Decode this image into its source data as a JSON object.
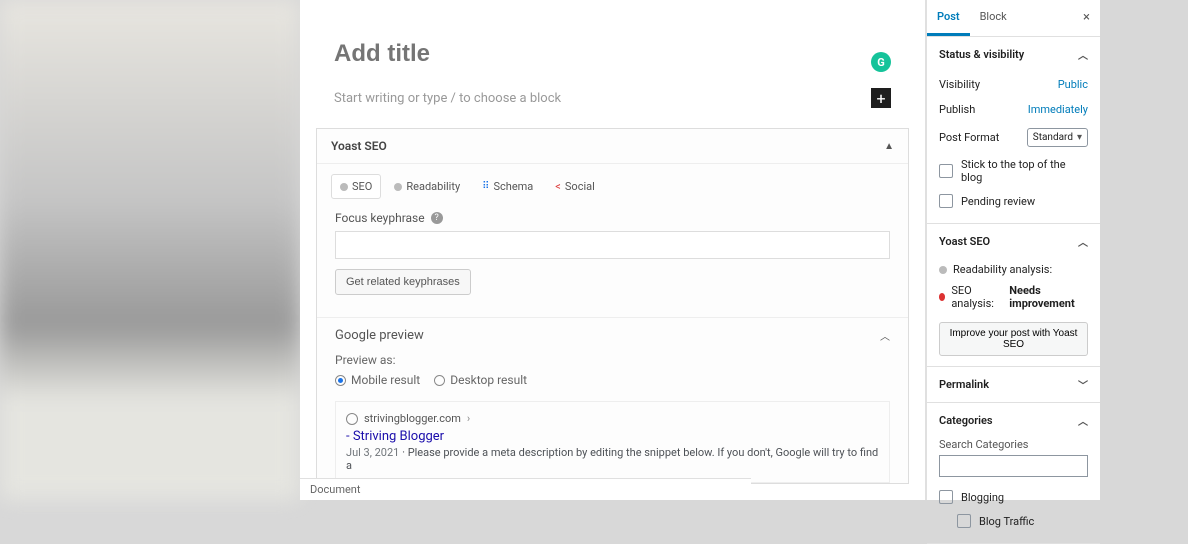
{
  "editor": {
    "title_placeholder": "Add title",
    "body_placeholder": "Start writing or type / to choose a block",
    "grammarly_label": "G"
  },
  "yoast": {
    "header": "Yoast SEO",
    "tabs": {
      "seo": "SEO",
      "readability": "Readability",
      "schema": "Schema",
      "social": "Social"
    },
    "focus_label": "Focus keyphrase",
    "related_btn": "Get related keyphrases",
    "google_preview": "Google preview",
    "preview_as": "Preview as:",
    "mobile": "Mobile result",
    "desktop": "Desktop result",
    "snippet": {
      "url": "strivingblogger.com",
      "title": "- Striving Blogger",
      "date": "Jul 3, 2021",
      "desc": "Please provide a meta description by editing the snippet below. If you don't, Google will try to find a"
    }
  },
  "footer": {
    "document": "Document"
  },
  "sidebar": {
    "tabs": {
      "post": "Post",
      "block": "Block"
    },
    "status": {
      "title": "Status & visibility",
      "visibility_label": "Visibility",
      "visibility_value": "Public",
      "publish_label": "Publish",
      "publish_value": "Immediately",
      "format_label": "Post Format",
      "format_value": "Standard",
      "stick": "Stick to the top of the blog",
      "pending": "Pending review"
    },
    "yoast_panel": {
      "title": "Yoast SEO",
      "readability": "Readability analysis:",
      "seo_label": "SEO analysis:",
      "seo_value": "Needs improvement",
      "improve_btn": "Improve your post with Yoast SEO"
    },
    "permalink": "Permalink",
    "categories": {
      "title": "Categories",
      "search": "Search Categories",
      "items": [
        "Blogging",
        "Blog Traffic"
      ]
    }
  }
}
